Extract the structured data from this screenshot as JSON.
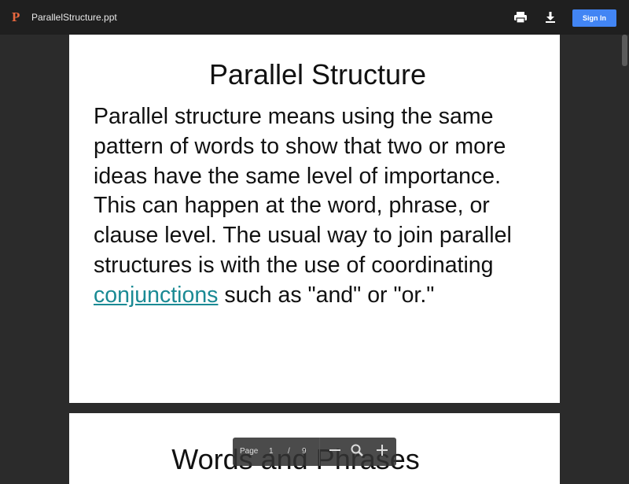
{
  "header": {
    "logo_letter": "P",
    "filename": "ParallelStructure.ppt",
    "signin_label": "Sign In",
    "icons": [
      "print-icon",
      "download-icon"
    ]
  },
  "slides": [
    {
      "title": "Parallel Structure",
      "body_before_link": "Parallel structure means using the same pattern of words to show that two or more ideas have the same level of importance. This can happen at the word, phrase, or clause level. The usual way to join parallel structures is with the use of coordinating ",
      "link_text": "conjunctions",
      "body_after_link": " such as \"and\" or \"or.\""
    },
    {
      "title": "Words and Phrases"
    }
  ],
  "pager": {
    "page_word": "Page",
    "current_page": "1",
    "separator": "/",
    "total_pages": "9",
    "icons": [
      "zoom-out-icon",
      "zoom-fit-icon",
      "zoom-in-icon"
    ]
  },
  "colors": {
    "accent_logo": "#e8683f",
    "signin_button": "#4285f4",
    "link": "#1a8a94"
  }
}
